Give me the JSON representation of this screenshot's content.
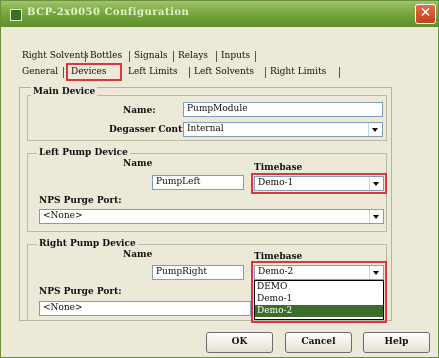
{
  "window": {
    "title": "BCP-2x0050 Configuration",
    "close_glyph": "✕"
  },
  "tabs_row1": [
    {
      "label": "Right Solvents"
    },
    {
      "label": "Bottles"
    },
    {
      "label": "Signals"
    },
    {
      "label": "Relays"
    },
    {
      "label": "Inputs"
    }
  ],
  "tabs_row2": [
    {
      "label": "General"
    },
    {
      "label": "Devices",
      "active": true
    },
    {
      "label": "Left Limits"
    },
    {
      "label": "Left Solvents"
    },
    {
      "label": "Right Limits"
    }
  ],
  "main_device": {
    "group_label": "Main Device",
    "name_label": "Name:",
    "name_value": "PumpModule",
    "degasser_label": "Degasser Control",
    "degasser_value": "Internal"
  },
  "left_pump": {
    "group_label": "Left Pump Device",
    "name_header": "Name",
    "timebase_header": "Timebase",
    "name_value": "PumpLeft",
    "timebase_value": "Demo-1",
    "purge_label": "NPS Purge Port:",
    "purge_value": "<None>"
  },
  "right_pump": {
    "group_label": "Right Pump Device",
    "name_header": "Name",
    "timebase_header": "Timebase",
    "name_value": "PumpRight",
    "timebase_value": "Demo-2",
    "purge_label": "NPS Purge Port:",
    "purge_value": "<None>",
    "dropdown_options": [
      "DEMO",
      "Demo-1",
      "Demo-2"
    ],
    "dropdown_selected": "Demo-2"
  },
  "buttons": {
    "ok": "OK",
    "cancel": "Cancel",
    "help": "Help"
  },
  "colors": {
    "titlebar": "#78a83f",
    "highlight_box": "#d63a3a",
    "selected_option": "#3d6d2a"
  }
}
